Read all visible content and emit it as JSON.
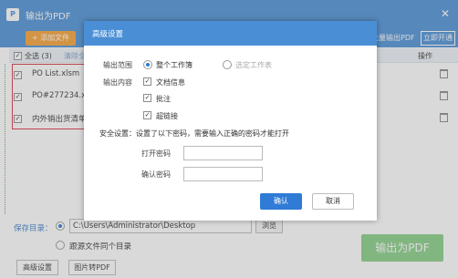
{
  "window": {
    "title": "输出为PDF",
    "logo_text": "P",
    "close_glyph": "✕"
  },
  "toolbar": {
    "add_file": "+ 添加文件",
    "batch_output": "批量输出PDF",
    "open_now": "立即开通"
  },
  "list": {
    "select_all": "全选 (3)",
    "clear_list": "清除全",
    "operation": "操作",
    "files": [
      {
        "name": "PO List.xlsm",
        "checked": true
      },
      {
        "name": "PO#277234.xls",
        "checked": true
      },
      {
        "name": "内外销出货清单",
        "checked": true
      }
    ]
  },
  "save": {
    "label": "保存目录：",
    "path": "C:\\Users\\Administrator\\Desktop",
    "browse": "浏览",
    "same_dir": "跟源文件同个目录"
  },
  "buttons": {
    "advanced": "高级设置",
    "image_to_pdf": "图片转PDF",
    "output_pdf": "输出为PDF"
  },
  "dialog": {
    "title": "高级设置",
    "output_range_label": "输出范围",
    "range_whole": "整个工作簿",
    "range_selected": "选定工作表",
    "output_content_label": "输出内容",
    "content_doc_info": "文档信息",
    "content_comments": "批注",
    "content_hyperlinks": "超链接",
    "security_text": "安全设置：设置了以下密码，需要输入正确的密码才能打开",
    "open_password_label": "打开密码",
    "confirm_password_label": "确认密码",
    "ok": "确认",
    "cancel": "取消"
  },
  "colors": {
    "accent": "#4a8fd6",
    "add_button": "#f7a032",
    "output_button": "#86cf86",
    "ok_button": "#2f7bd6",
    "highlight_frame": "#d9333f"
  }
}
